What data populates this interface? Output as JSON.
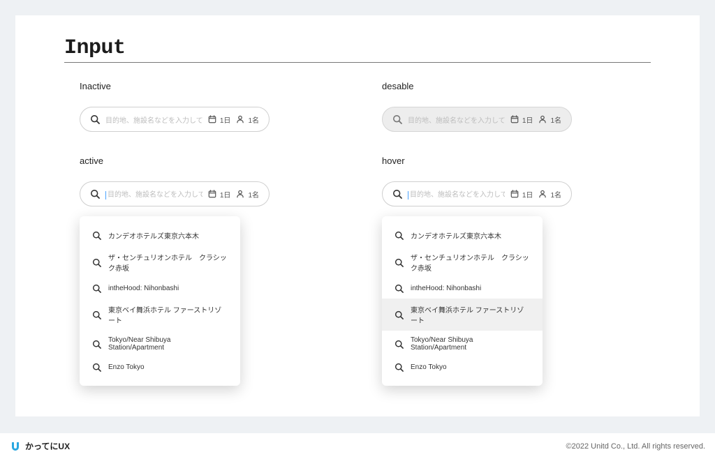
{
  "page_title": "Input",
  "states": {
    "inactive": {
      "label": "Inactive",
      "placeholder": "目的地、施設名などを入力してください",
      "date": "1日",
      "guests": "1名"
    },
    "disabled": {
      "label": "desable",
      "placeholder": "目的地、施設名などを入力してください",
      "date": "1日",
      "guests": "1名"
    },
    "active": {
      "label": "active",
      "placeholder": "目的地、施設名などを入力してください",
      "date": "1日",
      "guests": "1名"
    },
    "hover": {
      "label": "hover",
      "placeholder": "目的地、施設名などを入力してください",
      "date": "1日",
      "guests": "1名"
    }
  },
  "suggestions": [
    "カンデオホテルズ東京六本木",
    "ザ・センチュリオンホテル　クラシック赤坂",
    "intheHood: Nihonbashi",
    "東京ベイ舞浜ホテル ファーストリゾート",
    "Tokyo/Near Shibuya Station/Apartment",
    "Enzo Tokyo"
  ],
  "hover_index": 3,
  "footer": {
    "brand": "かってにUX",
    "copyright": "©2022 Unitd Co., Ltd. All rights reserved."
  }
}
